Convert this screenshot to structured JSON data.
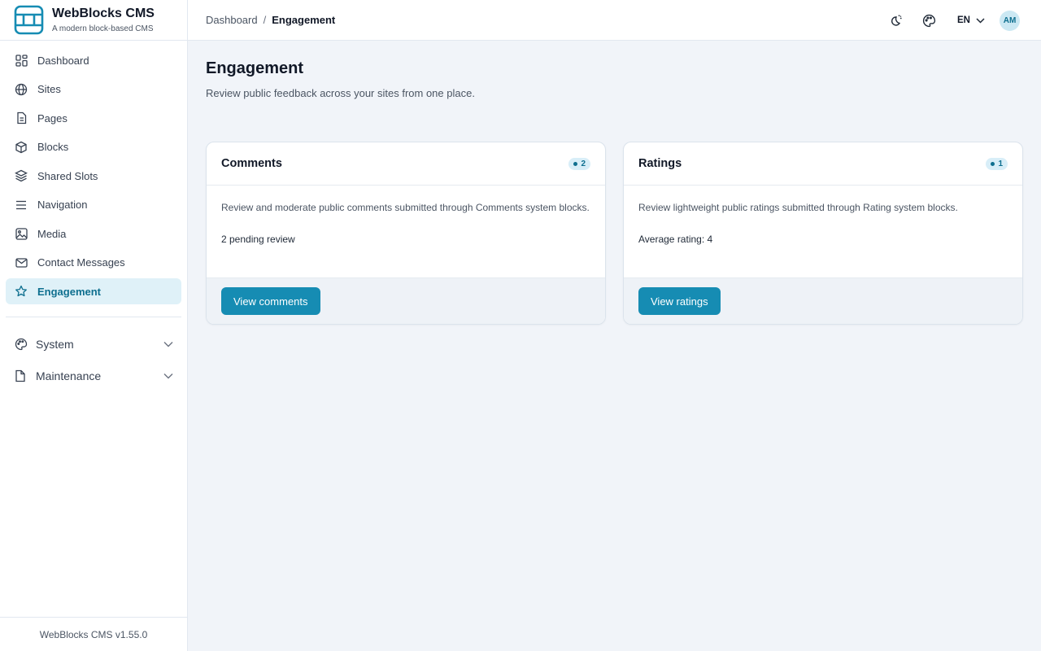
{
  "brand": {
    "name": "WebBlocks CMS",
    "tagline": "A modern block-based CMS"
  },
  "sidebar": {
    "items": [
      {
        "label": "Dashboard",
        "icon": "dashboard-grid-icon",
        "active": false
      },
      {
        "label": "Sites",
        "icon": "globe-icon",
        "active": false
      },
      {
        "label": "Pages",
        "icon": "document-icon",
        "active": false
      },
      {
        "label": "Blocks",
        "icon": "cube-icon",
        "active": false
      },
      {
        "label": "Shared Slots",
        "icon": "layers-icon",
        "active": false
      },
      {
        "label": "Navigation",
        "icon": "menu-lines-icon",
        "active": false
      },
      {
        "label": "Media",
        "icon": "image-icon",
        "active": false
      },
      {
        "label": "Contact Messages",
        "icon": "mail-icon",
        "active": false
      },
      {
        "label": "Engagement",
        "icon": "star-icon",
        "active": true
      }
    ],
    "groups": [
      {
        "label": "System",
        "icon": "palette-icon"
      },
      {
        "label": "Maintenance",
        "icon": "file-icon"
      }
    ],
    "footer": "WebBlocks CMS v1.55.0"
  },
  "topbar": {
    "breadcrumb_root": "Dashboard",
    "breadcrumb_sep": "/",
    "breadcrumb_current": "Engagement",
    "language": "EN",
    "avatar_initials": "AM"
  },
  "page": {
    "title": "Engagement",
    "subtitle": "Review public feedback across your sites from one place."
  },
  "cards": [
    {
      "title": "Comments",
      "badge": "2",
      "description": "Review and moderate public comments submitted through Comments system blocks.",
      "stat": "2 pending review",
      "button": "View comments"
    },
    {
      "title": "Ratings",
      "badge": "1",
      "description": "Review lightweight public ratings submitted through Rating system blocks.",
      "stat": "Average rating: 4",
      "button": "View ratings"
    }
  ],
  "colors": {
    "accent": "#168cb3",
    "active_bg": "#dff1f8",
    "page_bg": "#f1f4f9"
  }
}
